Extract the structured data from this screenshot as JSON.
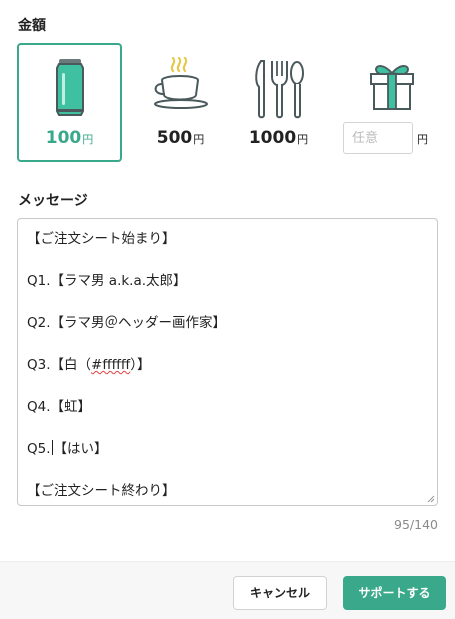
{
  "amount": {
    "label": "金額",
    "options": [
      {
        "value": "100",
        "unit": "円",
        "icon": "drink-can-icon",
        "selected": true
      },
      {
        "value": "500",
        "unit": "円",
        "icon": "coffee-cup-icon",
        "selected": false
      },
      {
        "value": "1000",
        "unit": "円",
        "icon": "fork-knife-spoon-icon",
        "selected": false
      }
    ],
    "custom": {
      "placeholder": "任意",
      "value": "",
      "unit": "円",
      "icon": "gift-box-icon"
    }
  },
  "message": {
    "label": "メッセージ",
    "lines": [
      "【ご注文シート始まり】",
      "",
      "Q1.【ラマ男 a.k.a.太郎】",
      "",
      "Q2.【ラマ男＠ヘッダー画作家】",
      "",
      "Q3.【白（#ffffff）】",
      "",
      "Q4.【虹】",
      "",
      "Q5.【はい】",
      "",
      "【ご注文シート終わり】"
    ],
    "q3_prefix": "Q3.【白（",
    "q3_hex": "#ffffff",
    "q3_suffix": "）】",
    "q5_prefix": "Q5.",
    "q5_suffix": "【はい】",
    "char_count": "95/140"
  },
  "footer": {
    "cancel_label": "キャンセル",
    "submit_label": "サポートする"
  },
  "colors": {
    "accent": "#3aa88a",
    "border": "#c8c8c8",
    "muted": "#8a8a8a"
  }
}
